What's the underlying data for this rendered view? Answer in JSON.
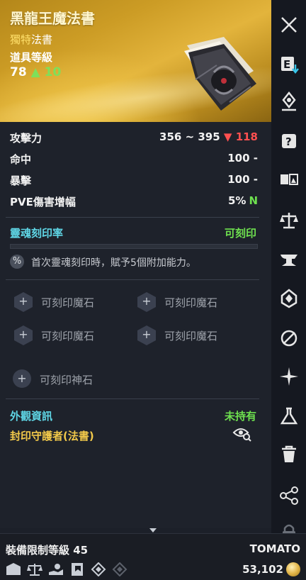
{
  "item": {
    "name": "黑龍王魔法書",
    "grade": "獨特",
    "type": "法書",
    "level_label": "道具等級",
    "level": "78",
    "level_bonus": "10"
  },
  "stats": [
    {
      "label": "攻擊力",
      "value": "356 ~ 395",
      "diff": "118",
      "diff_dir": "down"
    },
    {
      "label": "命中",
      "value": "100 -"
    },
    {
      "label": "暴擊",
      "value": "100 -"
    },
    {
      "label": "PVE傷害增幅",
      "value": "5%",
      "badge": "N"
    }
  ],
  "soul": {
    "label": "靈魂刻印率",
    "value": "可刻印",
    "note": "首次靈魂刻印時，賦予5個附加能力。"
  },
  "manastones": [
    "可刻印魔石",
    "可刻印魔石",
    "可刻印魔石",
    "可刻印魔石"
  ],
  "godstone": "可刻印神石",
  "appearance": {
    "label": "外觀資訊",
    "value": "未持有"
  },
  "seal": {
    "label": "封印守護者(法書)"
  },
  "footer": {
    "req_label": "裝備限制等級",
    "req_level": "45",
    "owner": "TOMATO",
    "price": "53,102"
  },
  "sidebar_icons": [
    "close-icon",
    "extract-icon",
    "enchant-icon",
    "scroll-icon",
    "compare-icon",
    "balance-icon",
    "anvil-icon",
    "crystal-icon",
    "unlink-icon",
    "sparkle-icon",
    "flask-icon",
    "trash-icon",
    "share-icon",
    "lock-icon"
  ],
  "colors": {
    "accent_cyan": "#5fd6e6",
    "green": "#6ee04f",
    "red": "#ff5050",
    "gold": "#f2c94a"
  }
}
